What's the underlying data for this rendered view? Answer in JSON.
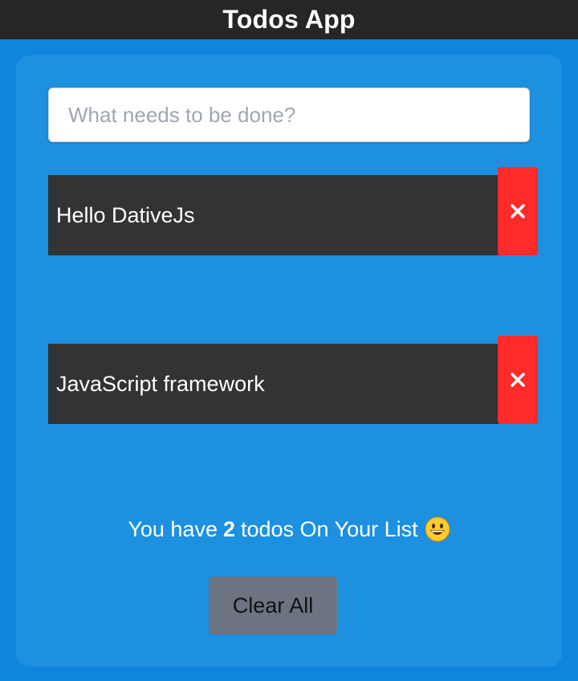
{
  "header": {
    "title": "Todos App"
  },
  "input": {
    "placeholder": "What needs to be done?",
    "value": ""
  },
  "todos": [
    {
      "text": "Hello DativeJs"
    },
    {
      "text": "JavaScript framework"
    }
  ],
  "summary": {
    "prefix": "You have",
    "count": "2",
    "suffix": "todos On Your List",
    "emoji": "grinning-face-icon"
  },
  "actions": {
    "clear_label": "Clear All"
  },
  "colors": {
    "page_bg": "#0e86dc",
    "card_bg": "#1e90e0",
    "header_bg": "#262626",
    "todo_bg": "#333333",
    "delete_bg": "#ff2a2a",
    "clear_bg": "#6c7482"
  }
}
